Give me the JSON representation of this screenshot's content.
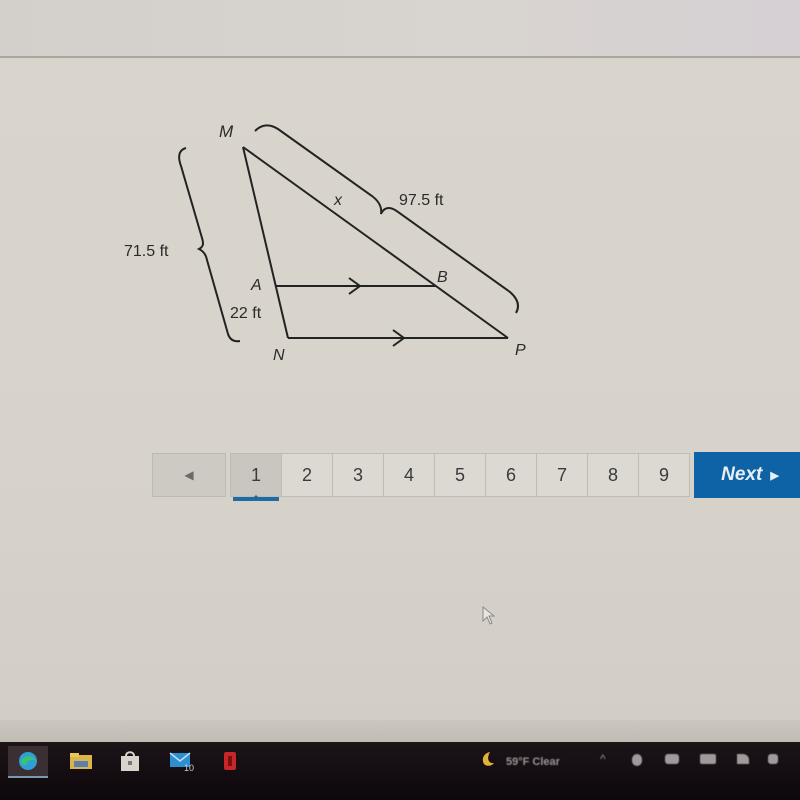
{
  "diagram": {
    "vertices": {
      "M": "M",
      "A": "A",
      "B": "B",
      "N": "N",
      "P": "P"
    },
    "labels": {
      "MN_length": "71.5 ft",
      "AN_length": "22 ft",
      "MP_length": "97.5 ft",
      "MB_unknown": "x"
    },
    "parallel_segments": [
      "AB",
      "NP"
    ]
  },
  "pagination": {
    "prev_icon": "◀",
    "pages": [
      "1",
      "2",
      "3",
      "4",
      "5",
      "6",
      "7",
      "8",
      "9"
    ],
    "current_page": "1",
    "next_label": "Next",
    "next_icon": "▶"
  },
  "colors": {
    "accent": "#0d63a5",
    "page_bg": "#d9d5cd",
    "line": "#222222"
  },
  "taskbar": {
    "apps": [
      {
        "name": "Microsoft Edge",
        "icon": "edge-icon"
      },
      {
        "name": "File Explorer",
        "icon": "folder-icon"
      },
      {
        "name": "Microsoft Store",
        "icon": "store-icon"
      },
      {
        "name": "Mail",
        "icon": "mail-icon",
        "badge": "10"
      },
      {
        "name": "Office",
        "icon": "office-icon"
      }
    ],
    "weather": {
      "icon": "moon-icon",
      "text": "59°F Clear"
    },
    "tray_icons": [
      "chevron-up-icon",
      "meet-icon",
      "cloud-icon",
      "battery-icon",
      "wifi-icon",
      "volume-icon"
    ]
  }
}
